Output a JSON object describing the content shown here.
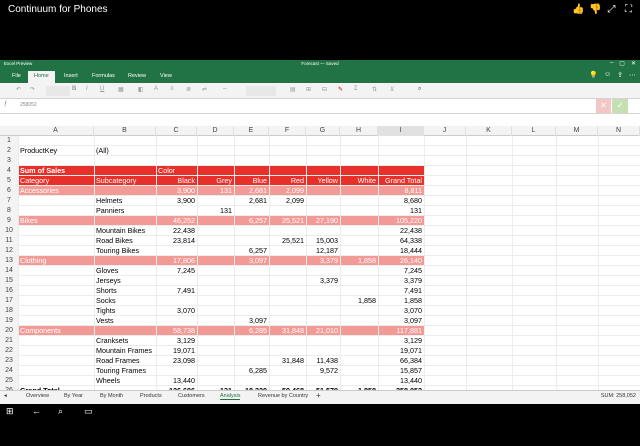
{
  "top": {
    "title": "Continuum for Phones",
    "icons": [
      "thumbs-up-icon",
      "thumbs-down-icon",
      "resize-icon",
      "expand-icon"
    ]
  },
  "excel": {
    "app_name": "Excel Preview",
    "doc_title": "Forecast — Saved",
    "tabs": [
      "File",
      "Home",
      "Insert",
      "Formulas",
      "Review",
      "View"
    ],
    "active_tab": "Home",
    "namebox": "258052",
    "ribbon_buttons": [
      "B",
      "I",
      "U"
    ],
    "colors": {
      "brand": "#217346",
      "header_red": "#e8302a",
      "band_pink": "#f29a96"
    }
  },
  "columns": [
    "A",
    "B",
    "C",
    "D",
    "E",
    "F",
    "G",
    "H",
    "I",
    "J",
    "K",
    "L",
    "M",
    "N"
  ],
  "rows": [
    "1",
    "2",
    "3",
    "4",
    "5",
    "6",
    "7",
    "8",
    "9",
    "10",
    "11",
    "12",
    "13",
    "14",
    "15",
    "16",
    "17",
    "18",
    "19",
    "20",
    "21",
    "22",
    "23",
    "24",
    "25",
    "26"
  ],
  "pivot": {
    "product_key_label": "ProductKey",
    "product_key_value": "(All)",
    "sum_label": "Sum of Sales",
    "color_label": "Color",
    "header": [
      "Category",
      "Subcategory",
      "Black",
      "Grey",
      "Blue",
      "Red",
      "Yellow",
      "White",
      "Grand Total"
    ],
    "groups": [
      {
        "category": "Accessories",
        "row": 6,
        "totals": [
          "3,900",
          "131",
          "2,681",
          "2,099",
          "",
          "",
          "8,811"
        ],
        "items": [
          {
            "row": 7,
            "name": "Helmets",
            "vals": [
              "3,900",
              "",
              "2,681",
              "2,099",
              "",
              "",
              "8,680"
            ]
          },
          {
            "row": 8,
            "name": "Panniers",
            "vals": [
              "",
              "131",
              "",
              "",
              "",
              "",
              "131"
            ]
          }
        ]
      },
      {
        "category": "Bikes",
        "row": 9,
        "totals": [
          "46,252",
          "",
          "6,257",
          "25,521",
          "27,190",
          "",
          "105,220"
        ],
        "items": [
          {
            "row": 10,
            "name": "Mountain Bikes",
            "vals": [
              "22,438",
              "",
              "",
              "",
              "",
              "",
              "22,438"
            ]
          },
          {
            "row": 11,
            "name": "Road Bikes",
            "vals": [
              "23,814",
              "",
              "",
              "25,521",
              "15,003",
              "",
              "64,338"
            ]
          },
          {
            "row": 12,
            "name": "Touring Bikes",
            "vals": [
              "",
              "",
              "6,257",
              "",
              "12,187",
              "",
              "18,444"
            ]
          }
        ]
      },
      {
        "category": "Clothing",
        "row": 13,
        "totals": [
          "17,806",
          "",
          "3,097",
          "",
          "3,379",
          "1,858",
          "26,140"
        ],
        "items": [
          {
            "row": 14,
            "name": "Gloves",
            "vals": [
              "7,245",
              "",
              "",
              "",
              "",
              "",
              "7,245"
            ]
          },
          {
            "row": 15,
            "name": "Jerseys",
            "vals": [
              "",
              "",
              "",
              "",
              "3,379",
              "",
              "3,379"
            ]
          },
          {
            "row": 16,
            "name": "Shorts",
            "vals": [
              "7,491",
              "",
              "",
              "",
              "",
              "",
              "7,491"
            ]
          },
          {
            "row": 17,
            "name": "Socks",
            "vals": [
              "",
              "",
              "",
              "",
              "",
              "1,858",
              "1,858"
            ]
          },
          {
            "row": 18,
            "name": "Tights",
            "vals": [
              "3,070",
              "",
              "",
              "",
              "",
              "",
              "3,070"
            ]
          },
          {
            "row": 19,
            "name": "Vests",
            "vals": [
              "",
              "",
              "3,097",
              "",
              "",
              "",
              "3,097"
            ]
          }
        ]
      },
      {
        "category": "Components",
        "row": 20,
        "totals": [
          "58,738",
          "",
          "6,285",
          "31,848",
          "21,010",
          "",
          "117,881"
        ],
        "items": [
          {
            "row": 21,
            "name": "Cranksets",
            "vals": [
              "3,129",
              "",
              "",
              "",
              "",
              "",
              "3,129"
            ]
          },
          {
            "row": 22,
            "name": "Mountain Frames",
            "vals": [
              "19,071",
              "",
              "",
              "",
              "",
              "",
              "19,071"
            ]
          },
          {
            "row": 23,
            "name": "Road Frames",
            "vals": [
              "23,098",
              "",
              "",
              "31,848",
              "11,438",
              "",
              "66,384"
            ]
          },
          {
            "row": 24,
            "name": "Touring Frames",
            "vals": [
              "",
              "",
              "6,285",
              "",
              "9,572",
              "",
              "15,857"
            ]
          },
          {
            "row": 25,
            "name": "Wheels",
            "vals": [
              "13,440",
              "",
              "",
              "",
              "",
              "",
              "13,440"
            ]
          }
        ]
      }
    ],
    "grand_total_label": "Grand Total",
    "grand_total_row": 26,
    "grand_totals": [
      "126,696",
      "131",
      "18,320",
      "59,468",
      "51,579",
      "1,858",
      "258,052"
    ]
  },
  "sheets": [
    "Overview",
    "By Year",
    "By Month",
    "Products",
    "Customers",
    "Analysis",
    "Revenue by Country"
  ],
  "active_sheet": "Analysis",
  "add_sheet": "+",
  "status_sum": "SUM: 258,052"
}
